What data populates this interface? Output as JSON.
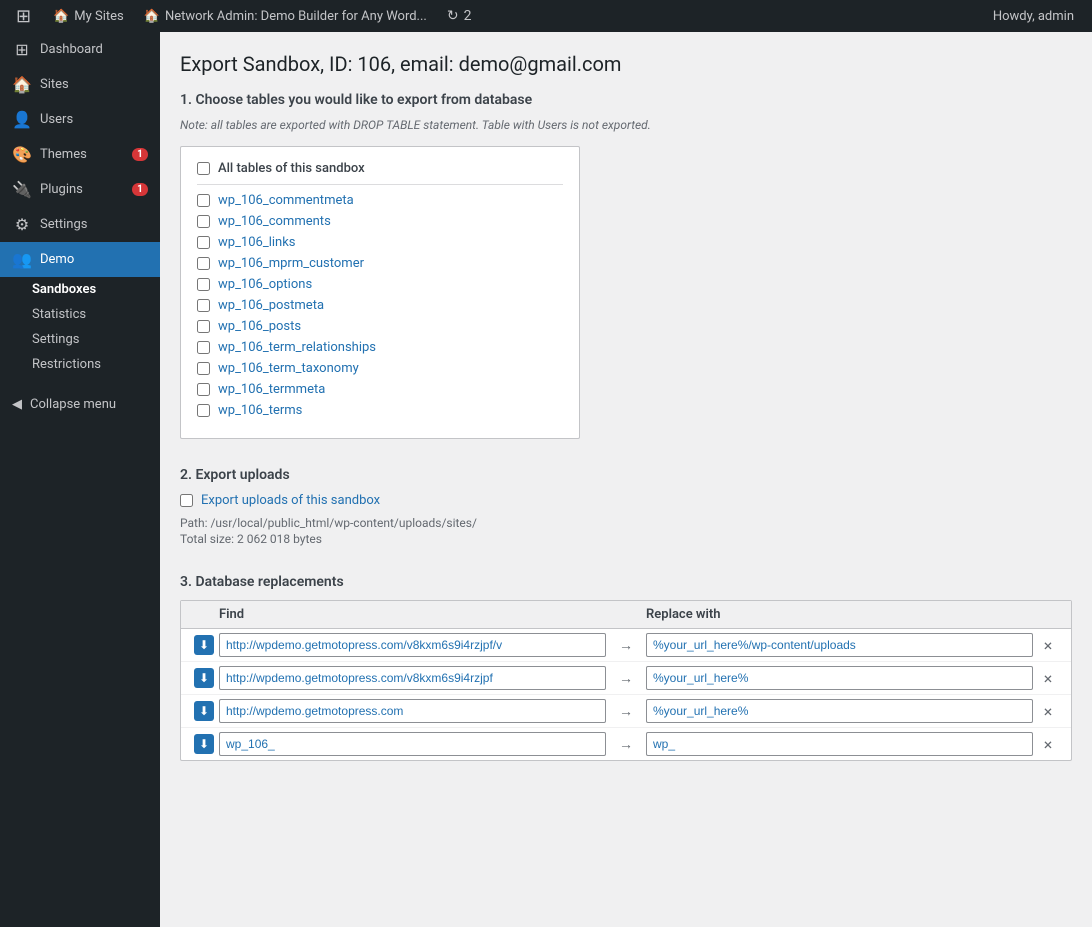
{
  "adminbar": {
    "logo": "W",
    "my_sites_label": "My Sites",
    "network_admin_label": "Network Admin: Demo Builder for Any Word...",
    "sync_count": "2",
    "howdy": "Howdy, admin"
  },
  "sidebar": {
    "items": [
      {
        "id": "dashboard",
        "label": "Dashboard",
        "icon": "⊞"
      },
      {
        "id": "sites",
        "label": "Sites",
        "icon": "🏠"
      },
      {
        "id": "users",
        "label": "Users",
        "icon": "👤"
      },
      {
        "id": "themes",
        "label": "Themes",
        "icon": "🎨",
        "badge": "1"
      },
      {
        "id": "plugins",
        "label": "Plugins",
        "icon": "🔌",
        "badge": "1"
      },
      {
        "id": "settings",
        "label": "Settings",
        "icon": "⚙"
      },
      {
        "id": "demo",
        "label": "Demo",
        "icon": "👥",
        "active": true
      }
    ],
    "sub_items": [
      {
        "id": "sandboxes",
        "label": "Sandboxes",
        "active": true
      },
      {
        "id": "statistics",
        "label": "Statistics"
      },
      {
        "id": "settings2",
        "label": "Settings"
      },
      {
        "id": "restrictions",
        "label": "Restrictions"
      }
    ],
    "collapse_label": "Collapse menu"
  },
  "page": {
    "title": "Export Sandbox, ID: 106, email: demo@gmail.com",
    "section1_heading": "1. Choose tables you would like to export from database",
    "note": "Note: all tables are exported with DROP TABLE statement. Table with Users is not exported.",
    "master_checkbox_label": "All tables of this sandbox",
    "tables": [
      "wp_106_commentmeta",
      "wp_106_comments",
      "wp_106_links",
      "wp_106_mprm_customer",
      "wp_106_options",
      "wp_106_postmeta",
      "wp_106_posts",
      "wp_106_term_relationships",
      "wp_106_term_taxonomy",
      "wp_106_termmeta",
      "wp_106_terms"
    ],
    "section2_heading": "2. Export uploads",
    "export_uploads_label": "Export uploads of this sandbox",
    "path_label": "Path: /usr/local/public_html/wp-content/uploads/sites/",
    "total_size_label": "Total size: 2 062 018 bytes",
    "section3_heading": "3. Database replacements",
    "db_col_find": "Find",
    "db_col_replace": "Replace with",
    "db_rows": [
      {
        "find": "http://wpdemo.getmotopress.com/v8kxm6s9i4rzjpf/v",
        "replace": "%your_url_here%/wp-content/uploads"
      },
      {
        "find": "http://wpdemo.getmotopress.com/v8kxm6s9i4rzjpf",
        "replace": "%your_url_here%"
      },
      {
        "find": "http://wpdemo.getmotopress.com",
        "replace": "%your_url_here%"
      },
      {
        "find": "wp_106_",
        "replace": "wp_"
      }
    ]
  }
}
